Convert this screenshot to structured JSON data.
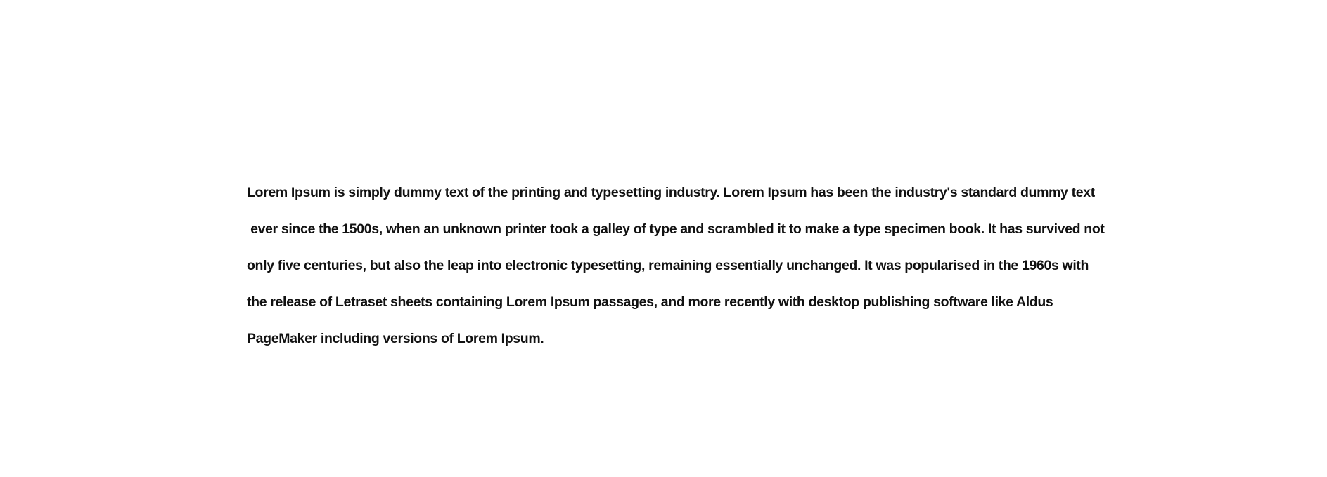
{
  "document": {
    "lines": [
      "Lorem Ipsum is simply dummy text of the printing and typesetting industry. Lorem Ipsum has been the industry's standard dummy text",
      " ever since the 1500s, when an unknown printer took a galley of type and scrambled it to make a type specimen book. It has survived not",
      "only five centuries, but also the leap into electronic typesetting, remaining essentially unchanged. It was popularised in the 1960s with",
      "the release of Letraset sheets containing Lorem Ipsum passages, and more recently with desktop publishing software like Aldus",
      "PageMaker including versions of Lorem Ipsum."
    ]
  }
}
